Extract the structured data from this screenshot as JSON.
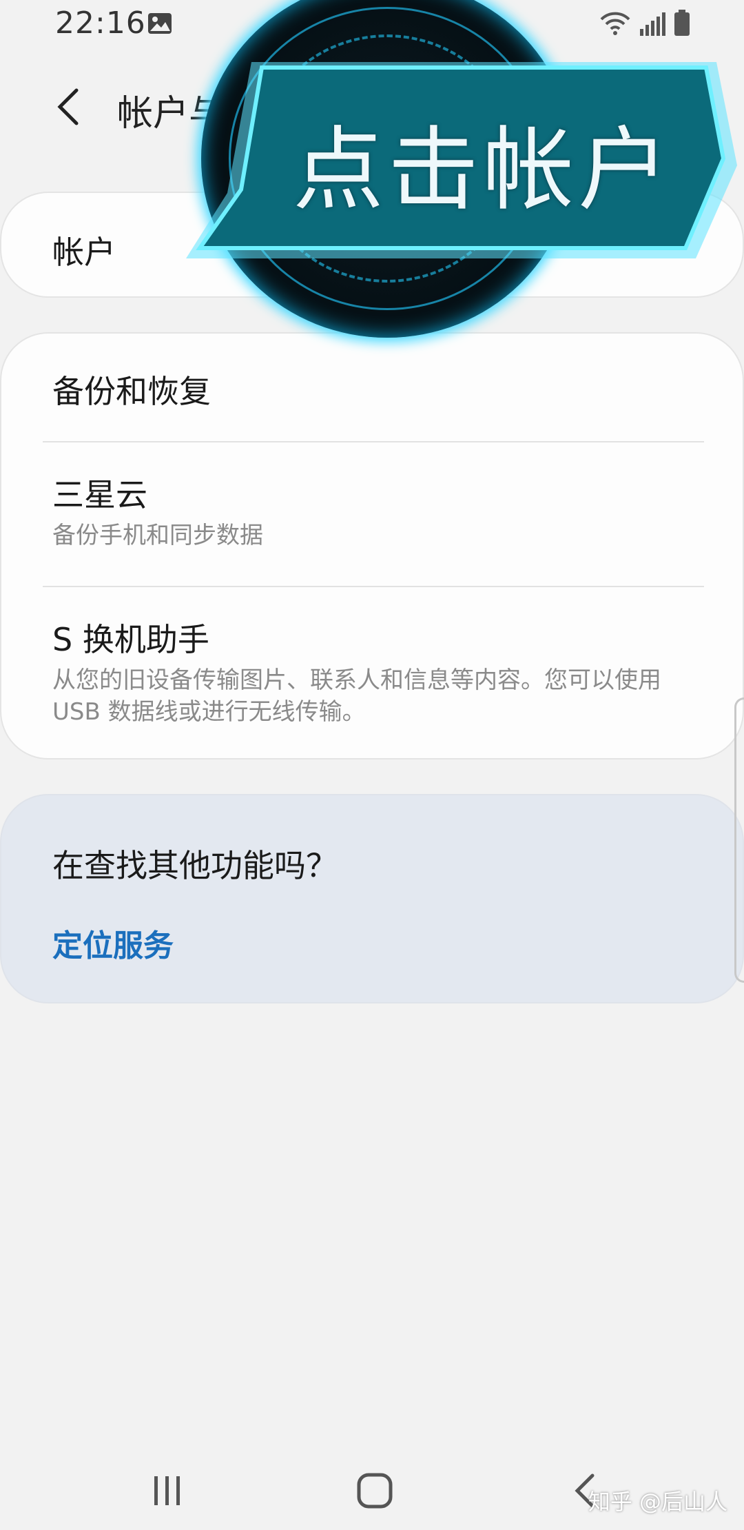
{
  "status_bar": {
    "time": "22:16",
    "icons": [
      "gallery-icon",
      "wifi-icon",
      "signal-icon",
      "battery-icon"
    ]
  },
  "header": {
    "back_icon": "chevron-left-icon",
    "title": "帐户与"
  },
  "overlay": {
    "text": "点击帐户",
    "colors": {
      "band": "#0b6a7a",
      "glow": "#43d9ff",
      "circle": "#061015"
    }
  },
  "account_card": {
    "title": "帐户"
  },
  "backup_card": {
    "items": [
      {
        "title": "备份和恢复",
        "subtitle": ""
      },
      {
        "title": "三星云",
        "subtitle": "备份手机和同步数据"
      },
      {
        "title": "S 换机助手",
        "subtitle": "从您的旧设备传输图片、联系人和信息等内容。您可以使用 USB 数据线或进行无线传输。"
      }
    ]
  },
  "other_card": {
    "title": "在查找其他功能吗？",
    "link": "定位服务",
    "link_color": "#1b6fbd"
  },
  "nav_bar": {
    "buttons": [
      "recent-apps-icon",
      "home-icon",
      "back-icon"
    ]
  },
  "watermark": "知乎 @后山人"
}
